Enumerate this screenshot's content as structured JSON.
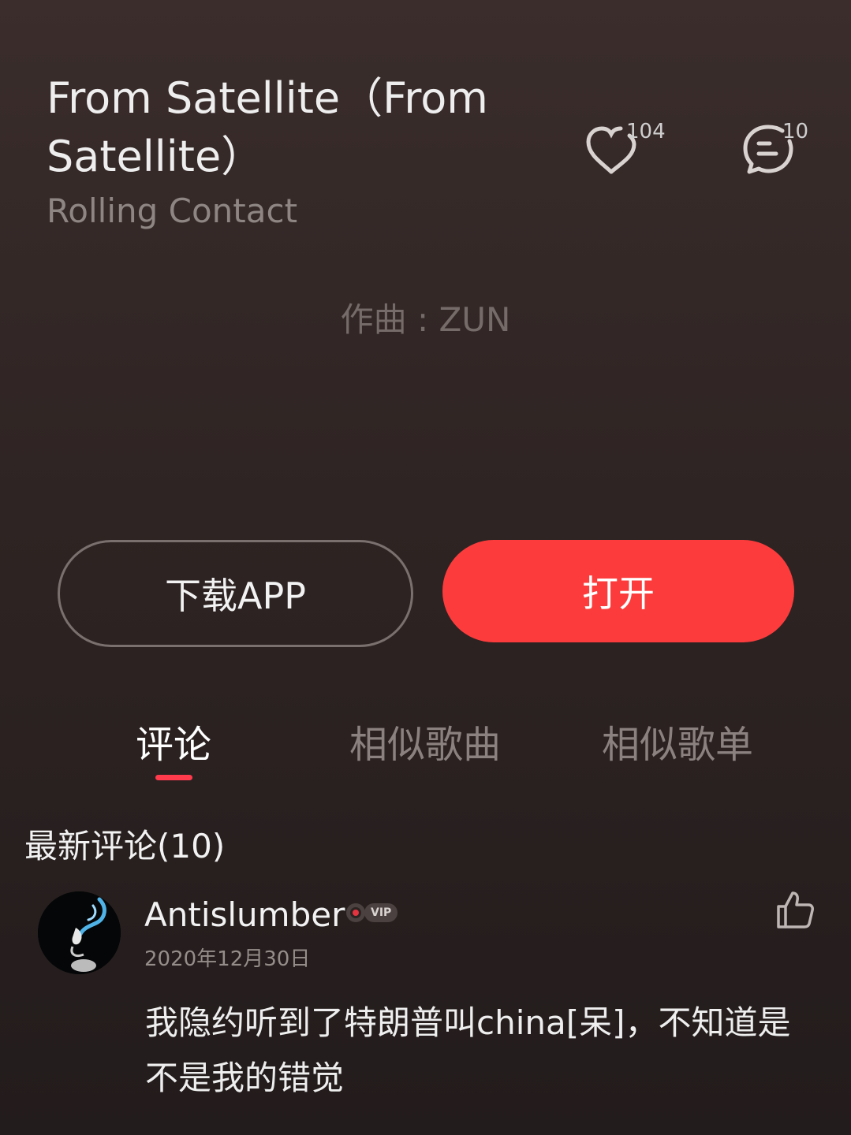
{
  "song": {
    "title": "From Satellite（From Satellite）",
    "artist": "Rolling Contact"
  },
  "stats": {
    "likes": "104",
    "comments": "10"
  },
  "lyrics": {
    "current_line": "作曲 : ZUN"
  },
  "actions": {
    "download_label": "下载APP",
    "open_label": "打开"
  },
  "tabs": [
    {
      "label": "评论",
      "active": true
    },
    {
      "label": "相似歌曲",
      "active": false
    },
    {
      "label": "相似歌单",
      "active": false
    }
  ],
  "comments_section": {
    "title": "最新评论(10)",
    "items": [
      {
        "user": "Antislumber",
        "badge": "VIP",
        "date": "2020年12月30日",
        "text": "我隐约听到了特朗普叫china[呆]，不知道是不是我的错觉"
      }
    ]
  },
  "colors": {
    "accent": "#fc3c3c",
    "tab_indicator": "#ff3b4c",
    "background_top": "#3a2d2b",
    "background_bottom": "#231c1c"
  }
}
